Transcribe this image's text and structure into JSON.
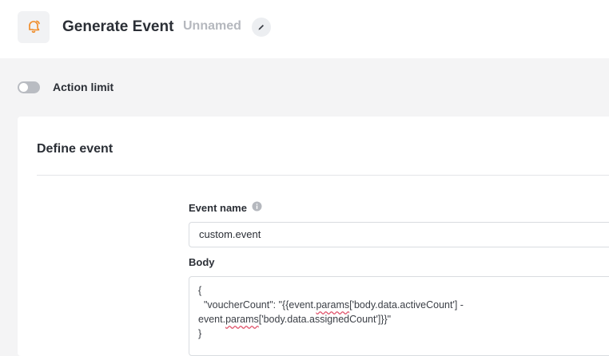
{
  "header": {
    "title": "Generate Event",
    "subtitle": "Unnamed"
  },
  "action_limit": {
    "label": "Action limit",
    "enabled": false
  },
  "define_event": {
    "title": "Define event",
    "event_name_label": "Event name",
    "event_name_value": "custom.event",
    "body_label": "Body",
    "body_lines": [
      "{",
      "  \"voucherCount\": \"{{event.",
      "params",
      "['body.data.activeCount'] -",
      "event.",
      "params",
      "['body.data.assignedCount']}}\"",
      "}"
    ]
  },
  "colors": {
    "accent": "#f08a24",
    "toggle_off": "#b9bcc2",
    "spell_underline": "#e0526a"
  },
  "icons": {
    "app": "bell-ring-icon",
    "edit": "pencil-icon",
    "info": "info-icon"
  }
}
